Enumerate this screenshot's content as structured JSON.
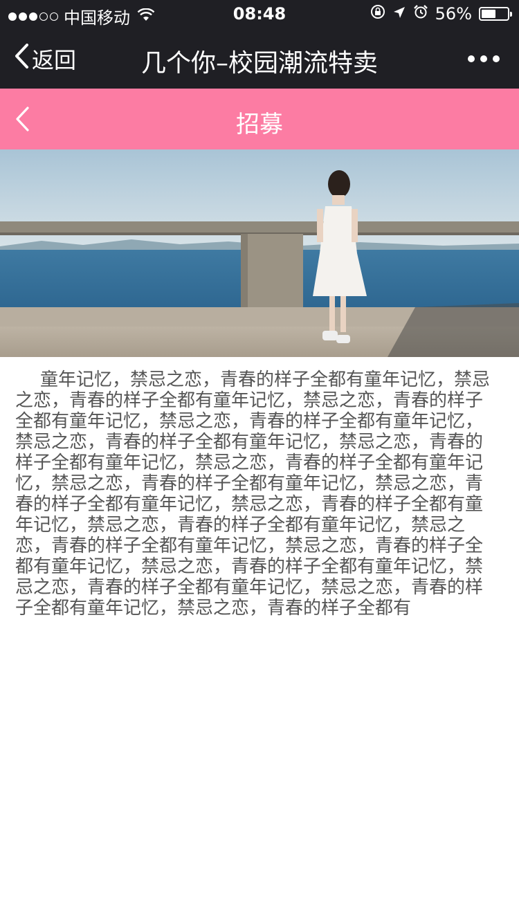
{
  "status_bar": {
    "carrier": "中国移动",
    "time": "08:48",
    "battery_percent_text": "56%",
    "battery_level": 0.56,
    "icons": [
      "wifi-icon",
      "rotation-lock-icon",
      "location-icon",
      "alarm-icon",
      "battery-icon"
    ]
  },
  "nav": {
    "back_label": "返回",
    "title": "几个你–校园潮流特卖",
    "more_icon": "more-dots-icon"
  },
  "header": {
    "title": "招募",
    "back_icon": "chevron-left-icon"
  },
  "banner": {
    "icon": "banner-photo"
  },
  "article": {
    "text": "童年记忆，禁忌之恋，青春的样子全都有童年记忆，禁忌之恋，青春的样子全都有童年记忆，禁忌之恋，青春的样子全都有童年记忆，禁忌之恋，青春的样子全都有童年记忆，禁忌之恋，青春的样子全都有童年记忆，禁忌之恋，青春的样子全都有童年记忆，禁忌之恋，青春的样子全都有童年记忆，禁忌之恋，青春的样子全都有童年记忆，禁忌之恋，青春的样子全都有童年记忆，禁忌之恋，青春的样子全都有童年记忆，禁忌之恋，青春的样子全都有童年记忆，禁忌之恋，青春的样子全都有童年记忆，禁忌之恋，青春的样子全都有童年记忆，禁忌之恋，青春的样子全都有童年记忆，禁忌之恋，青春的样子全都有童年记忆，禁忌之恋，青春的样子全都有童年记忆，禁忌之恋，青春的样子全都有"
  },
  "colors": {
    "topbar": "#1f1f24",
    "accent_pink": "#fc7ca3",
    "text_gray": "#555555"
  }
}
